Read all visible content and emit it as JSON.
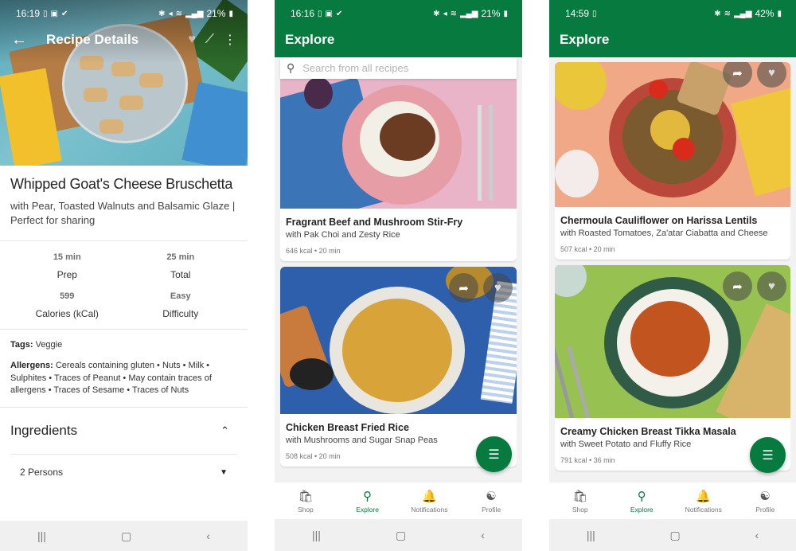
{
  "screens": {
    "recipe_details": {
      "status": {
        "time": "16:19",
        "left_icons": [
          "sim-icon",
          "image-icon",
          "check-icon"
        ],
        "right_icons": [
          "bluetooth-icon",
          "mute-icon",
          "wifi-icon",
          "volte-icon",
          "signal-icon"
        ],
        "battery": "21%"
      },
      "appbar": {
        "title": "Recipe Details",
        "back_icon": "←",
        "share_icon": "⤴",
        "more_icon": "⋮"
      },
      "recipe": {
        "title": "Whipped Goat's Cheese Bruschetta",
        "subtitle": "with Pear, Toasted Walnuts and Balsamic Glaze | Perfect for sharing"
      },
      "stats": [
        {
          "value": "15 min",
          "label": "Prep"
        },
        {
          "value": "25 min",
          "label": "Total"
        },
        {
          "value": "599",
          "label": "Calories (kCal)"
        },
        {
          "value": "Easy",
          "label": "Difficulty"
        }
      ],
      "tags": {
        "label": "Tags:",
        "value": " Veggie"
      },
      "allergens": {
        "label": "Allergens:",
        "value": " Cereals containing gluten • Nuts • Milk • Sulphites • Traces of Peanut • May contain traces of allergens • Traces of Sesame • Traces of Nuts"
      },
      "ingredients": {
        "heading": "Ingredients",
        "collapse_icon": "⌃",
        "servings": "2 Persons",
        "dropdown_icon": "▼"
      }
    },
    "explore_1": {
      "status": {
        "time": "16:16",
        "battery": "21%"
      },
      "title": "Explore",
      "search": {
        "placeholder": "Search from all recipes"
      },
      "cards": [
        {
          "name": "Fragrant Beef and Mushroom Stir-Fry",
          "subtitle": "with Pak Choi and Zesty Rice",
          "meta": "646 kcal • 20 min"
        },
        {
          "name": "Chicken Breast Fried Rice",
          "subtitle": "with Mushrooms and Sugar Snap Peas",
          "meta": "508 kcal • 20 min"
        }
      ]
    },
    "explore_2": {
      "status": {
        "time": "14:59",
        "battery": "42%"
      },
      "title": "Explore",
      "cards": [
        {
          "name": "Chermoula Cauliflower on Harissa Lentils",
          "subtitle": "with Roasted Tomatoes, Za'atar Ciabatta and Cheese",
          "meta": "507 kcal • 20 min"
        },
        {
          "name": "Creamy Chicken Breast Tikka Masala",
          "subtitle": "with Sweet Potato and Fluffy Rice",
          "meta": "791 kcal • 36 min"
        }
      ]
    }
  },
  "bottom_nav": [
    {
      "label": "Shop",
      "icon": "shopping-bag-icon",
      "active": false
    },
    {
      "label": "Explore",
      "icon": "explore-search-icon",
      "active": true
    },
    {
      "label": "Notifications",
      "icon": "bell-icon",
      "active": false
    },
    {
      "label": "Profile",
      "icon": "profile-icon",
      "active": false
    }
  ],
  "icons": {
    "share": "➦",
    "heart": "♥",
    "filter": "☰",
    "search": "⚲",
    "recents": "|||",
    "home": "▢",
    "back": "‹"
  },
  "colors": {
    "brand_green": "#067a3f",
    "text_dark": "#242424",
    "muted": "#777777"
  }
}
